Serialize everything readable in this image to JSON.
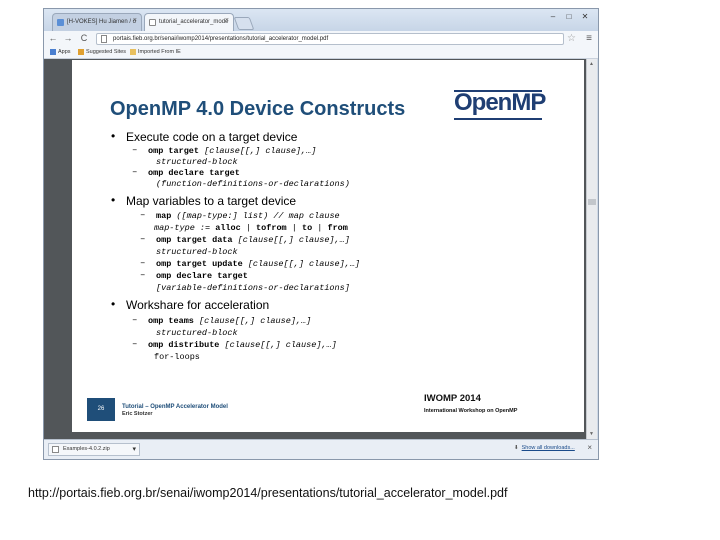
{
  "browser": {
    "tabs": [
      {
        "label": "[H-VOKES] Hu Jiamen / o",
        "active": false
      },
      {
        "label": "tutorial_accelerator_mode",
        "active": true
      }
    ],
    "window_controls": {
      "minimize": "–",
      "maximize": "□",
      "close": "✕"
    },
    "nav": {
      "back": "←",
      "forward": "→",
      "reload": "C"
    },
    "address": "portais.fieb.org.br/senai/iwomp2014/presentations/tutorial_accelerator_model.pdf",
    "bookmarks": [
      {
        "label": "Apps"
      },
      {
        "label": "Suggested Sites"
      },
      {
        "label": "Imported From IE"
      }
    ],
    "download": {
      "file": "Examples-4.0.2.zip",
      "show_all": "Show all downloads..."
    }
  },
  "slide": {
    "title": "OpenMP 4.0 Device Constructs",
    "logo": "OpenMP",
    "bullets": [
      {
        "text": "Execute code on a target device"
      },
      {
        "text": "Map variables to a target device"
      },
      {
        "text": "Workshare for acceleration"
      }
    ],
    "code": {
      "l1_kw": "omp target",
      "l1_rest": " [clause[[,] clause],…]",
      "l2": "structured-block",
      "l3_kw": "omp declare target",
      "l4": "(function-definitions-or-declarations)",
      "l5_kw": "map",
      "l5_rest": " ([map-type:] list) // map clause",
      "l6_a": "map-type := ",
      "l6_b": "alloc",
      "l6_c": " | ",
      "l6_d": "tofrom",
      "l6_e": " | ",
      "l6_f": "to",
      "l6_g": " | ",
      "l6_h": "from",
      "l7_kw": "omp target data",
      "l7_rest": " [clause[[,] clause],…]",
      "l8": "structured-block",
      "l9_kw": "omp target update",
      "l9_rest": " [clause[[,] clause],…]",
      "l10_kw": "omp declare target",
      "l11": "[variable-definitions-or-declarations]",
      "l12_kw": "omp teams",
      "l12_rest": " [clause[[,] clause],…]",
      "l13": "structured-block",
      "l14_kw": "omp distribute",
      "l14_rest": " [clause[[,] clause],…]",
      "l15": "for-loops"
    },
    "footer": {
      "page": "26",
      "title": "Tutorial – OpenMP Accelerator Model",
      "author": "Eric Stotzer",
      "event": "IWOMP 2014",
      "event_sub": "International Workshop on OpenMP"
    }
  },
  "caption": "http://portais.fieb.org.br/senai/iwomp2014/presentations/tutorial_accelerator_model.pdf",
  "colors": {
    "slide_title": "#1f4e79",
    "viewer_bg": "#525659",
    "chrome": "#cfd9e6"
  }
}
